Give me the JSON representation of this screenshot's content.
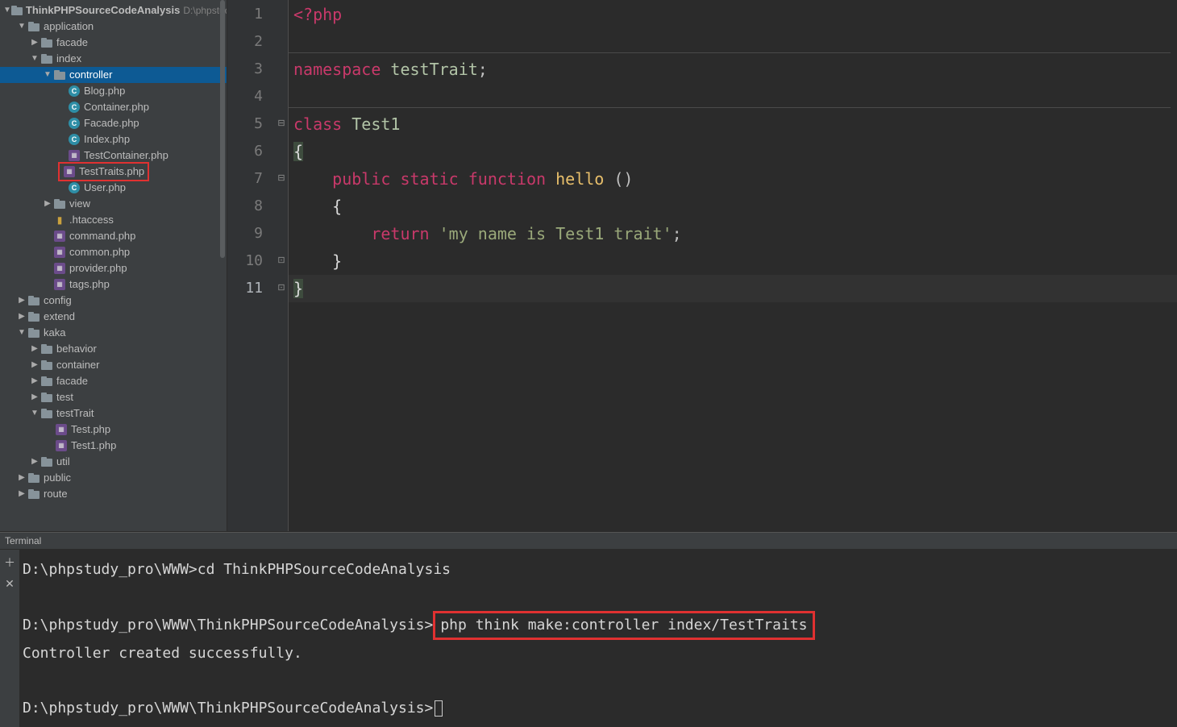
{
  "project": {
    "name": "ThinkPHPSourceCodeAnalysis",
    "path": "D:\\phpstudy"
  },
  "tree": {
    "application": "application",
    "facade": "facade",
    "index": "index",
    "controller": "controller",
    "files": {
      "blog": "Blog.php",
      "container": "Container.php",
      "facade": "Facade.php",
      "index": "Index.php",
      "testcontainer": "TestContainer.php",
      "testtraits": "TestTraits.php",
      "user": "User.php"
    },
    "view": "view",
    "htaccess": ".htaccess",
    "command": "command.php",
    "common": "common.php",
    "provider": "provider.php",
    "tags": "tags.php",
    "config": "config",
    "extend": "extend",
    "kaka": "kaka",
    "behavior": "behavior",
    "container2": "container",
    "facade2": "facade",
    "test": "test",
    "testTrait": "testTrait",
    "testphp": "Test.php",
    "test1php": "Test1.php",
    "util": "util",
    "public": "public",
    "route": "route"
  },
  "editor": {
    "lines": {
      "l1_open": "<?php",
      "l3_ns": "namespace",
      "l3_name": " testTrait",
      "l3_semi": ";",
      "l5_class": "class",
      "l5_name": " Test1",
      "l6_brace": "{",
      "l7_pub": "public",
      "l7_static": " static",
      "l7_func": " function",
      "l7_hello": " hello",
      "l7_parens": " ()",
      "l8_brace": "{",
      "l9_return": "return",
      "l9_str": " 'my name is Test1 trait'",
      "l9_semi": ";",
      "l10_brace": "}",
      "l11_brace": "}"
    },
    "linenums": [
      "1",
      "2",
      "3",
      "4",
      "5",
      "6",
      "7",
      "8",
      "9",
      "10",
      "11"
    ]
  },
  "terminal": {
    "tab": "Terminal",
    "l1a": "D:\\phpstudy_pro\\WWW>",
    "l1b": "cd ThinkPHPSourceCodeAnalysis",
    "l2a": "D:\\phpstudy_pro\\WWW\\ThinkPHPSourceCodeAnalysis>",
    "l2b": "php think make:controller index/TestTraits",
    "l3": "Controller created successfully.",
    "l4": "D:\\phpstudy_pro\\WWW\\ThinkPHPSourceCodeAnalysis>"
  }
}
